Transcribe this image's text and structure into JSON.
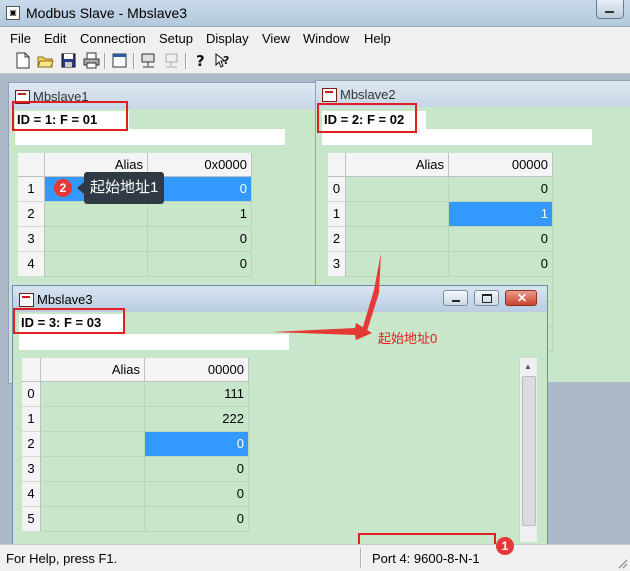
{
  "window": {
    "title": "Modbus Slave - Mbslave3"
  },
  "menu": [
    "File",
    "Edit",
    "Connection",
    "Setup",
    "Display",
    "View",
    "Window",
    "Help"
  ],
  "toolbar_icons": [
    "new-document-icon",
    "open-folder-icon",
    "save-icon",
    "print-icon",
    "window-icon",
    "connect-icon",
    "disconnect-icon",
    "help-icon",
    "context-help-icon"
  ],
  "mbslave1": {
    "title": "Mbslave1",
    "header": "ID = 1: F = 01",
    "col_alias": "Alias",
    "col_addr": "0x0000",
    "rows": [
      {
        "index": "1",
        "value": "0",
        "selected": true
      },
      {
        "index": "2",
        "value": "1",
        "selected": false
      },
      {
        "index": "3",
        "value": "0",
        "selected": false
      },
      {
        "index": "4",
        "value": "0",
        "selected": false
      }
    ],
    "tooltip": "起始地址1",
    "badge": "2"
  },
  "mbslave2": {
    "title": "Mbslave2",
    "header": "ID = 2: F = 02",
    "col_alias": "Alias",
    "col_addr": "00000",
    "rows": [
      {
        "index": "0",
        "value": "0",
        "selected": false
      },
      {
        "index": "1",
        "value": "1",
        "selected": true
      },
      {
        "index": "2",
        "value": "0",
        "selected": false
      },
      {
        "index": "3",
        "value": "0",
        "selected": false
      }
    ]
  },
  "mbslave3": {
    "title": "Mbslave3",
    "header": "ID = 3: F = 03",
    "col_alias": "Alias",
    "col_addr": "00000",
    "rows": [
      {
        "index": "0",
        "value": "111",
        "selected": false
      },
      {
        "index": "1",
        "value": "222",
        "selected": false
      },
      {
        "index": "2",
        "value": "0",
        "selected": true
      },
      {
        "index": "3",
        "value": "0",
        "selected": false
      },
      {
        "index": "4",
        "value": "0",
        "selected": false
      },
      {
        "index": "5",
        "value": "0",
        "selected": false
      }
    ]
  },
  "annotation": {
    "text": "起始地址0"
  },
  "status": {
    "help": "For Help, press F1.",
    "port": "Port 4: 9600-8-N-1",
    "badge": "1"
  },
  "colors": {
    "accent": "#e02020",
    "selection": "#3399ff",
    "grid_bg": "#c8e6c9"
  }
}
